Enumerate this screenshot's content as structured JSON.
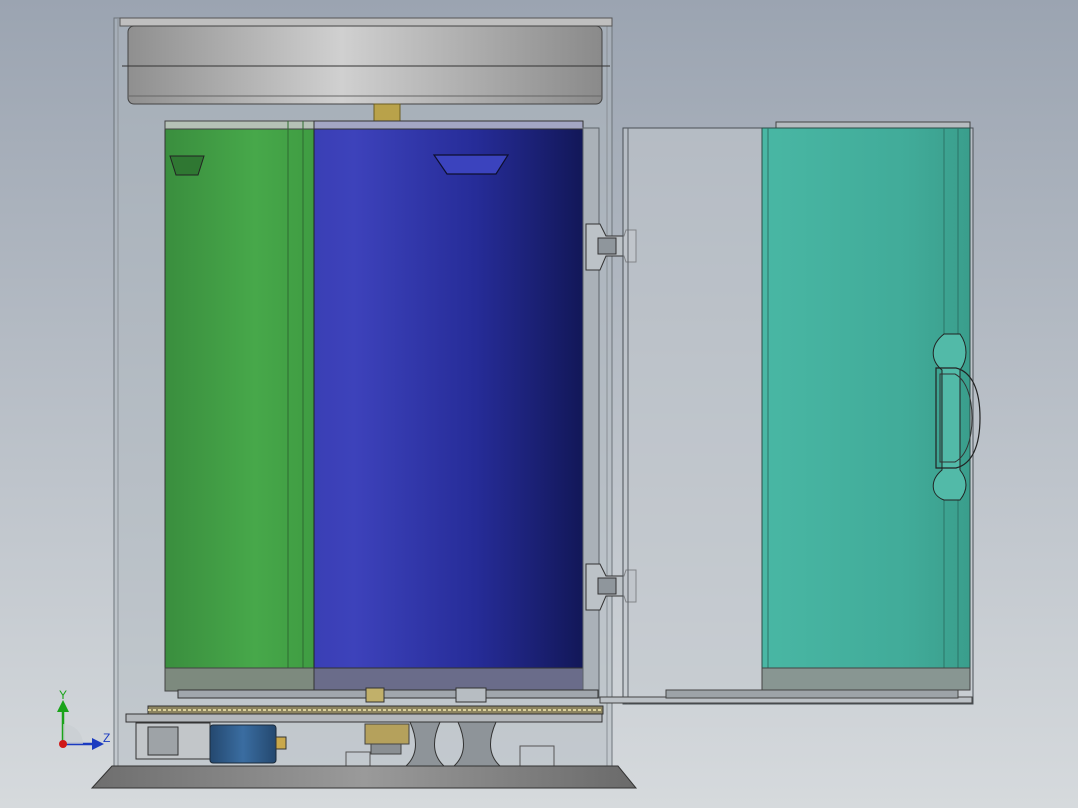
{
  "viewport": {
    "colors": {
      "bg_top": "#9ba4b1",
      "bg_bottom": "#d6dadd",
      "bin_green": "#3f9c42",
      "bin_blue": "#272e9f",
      "bin_teal": "#45b2a0",
      "housing_glass": "#b2b9c1",
      "metal": "#9a9a9a",
      "brass": "#b9a24a",
      "motor_blue": "#2f5b8a"
    }
  },
  "triad": {
    "y_label": "Y",
    "z_label": "Z"
  }
}
